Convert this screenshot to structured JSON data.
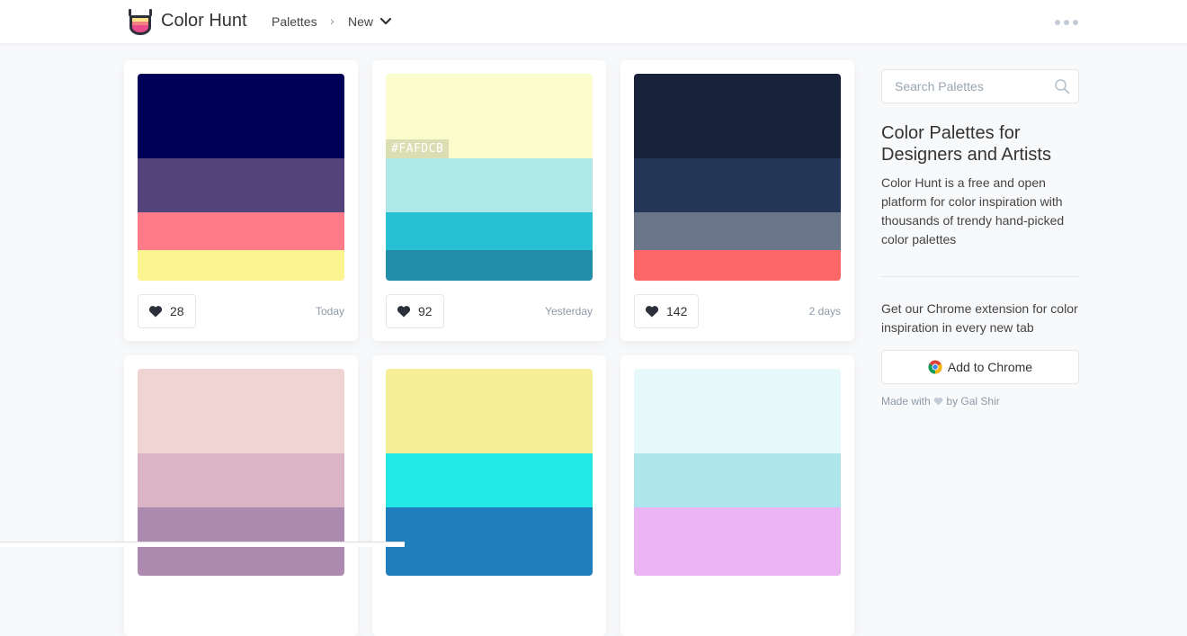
{
  "header": {
    "brand": "Color Hunt",
    "nav_palettes": "Palettes",
    "nav_separator": "›",
    "nav_new": "New"
  },
  "cards": [
    {
      "colors": [
        "#000058",
        "#52447b",
        "#ff7b8a",
        "#fcf391"
      ],
      "likes": "28",
      "date": "Today"
    },
    {
      "colors": [
        "#fafdcb",
        "#aee9e7",
        "#28c1d4",
        "#238eaa"
      ],
      "likes": "92",
      "date": "Yesterday",
      "hex_label": "#FAFDCB"
    },
    {
      "colors": [
        "#18233b",
        "#233658",
        "#6b758a",
        "#fd6768"
      ],
      "likes": "142",
      "date": "2 days"
    },
    {
      "colors": [
        "#f0d4d4",
        "#dbb5c5",
        "#ad8bb0"
      ]
    },
    {
      "colors": [
        "#f5ee96",
        "#22e8e6",
        "#1f7ebc"
      ]
    },
    {
      "colors": [
        "#e7f8fa",
        "#ade5ea",
        "#ebb4f3"
      ]
    }
  ],
  "sidebar": {
    "search_placeholder": "Search Palettes",
    "title": "Color Palettes for Designers and Artists",
    "description": "Color Hunt is a free and open platform for color inspiration with thousands of trendy hand-picked color palettes",
    "chrome_text": "Get our Chrome extension for color inspiration in every new tab",
    "chrome_button": "Add to Chrome",
    "made_with_prefix": "Made with",
    "made_with_suffix": "by Gal Shir"
  },
  "icons": {
    "logo": "color-hunt-logo",
    "chevron": "chevron-down-icon",
    "more": "more-dots-icon",
    "heart": "heart-icon",
    "search": "search-icon",
    "chrome": "chrome-logo-icon"
  },
  "colors": {
    "heart": "#2b303a",
    "muted_text": "#8d9aa6"
  }
}
